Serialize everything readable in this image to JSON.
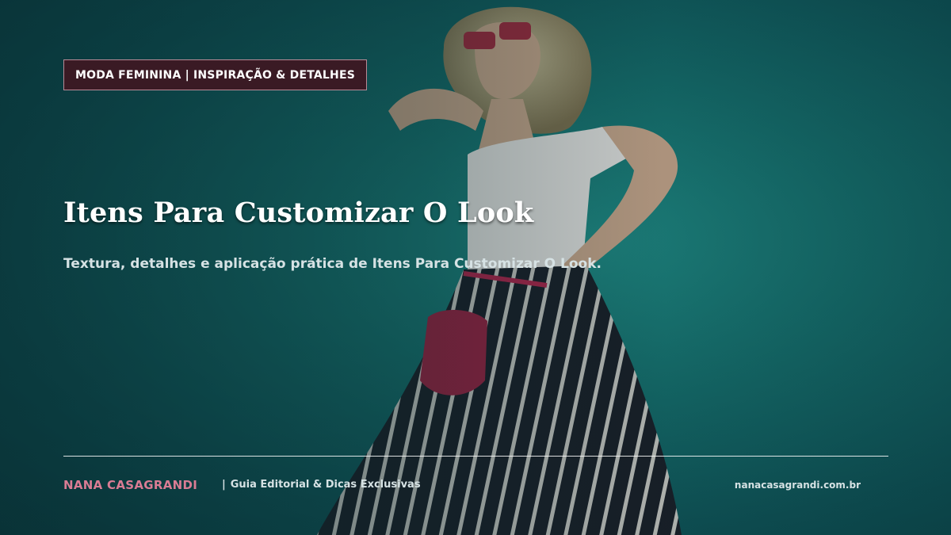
{
  "badge": {
    "label": "MODA FEMININA | INSPIRAÇÃO & DETALHES"
  },
  "hero": {
    "title": "Itens Para Customizar O Look",
    "subtitle": "Textura, detalhes e aplicação prática de Itens Para Customizar O Look."
  },
  "footer": {
    "brand": "NANA CASAGRANDI",
    "separator": "|",
    "tagline": "Guia Editorial & Dicas Exclusivas",
    "site": "nanacasagrandi.com.br"
  },
  "colors": {
    "background": "#156e6c",
    "badge_bg": "#3a1a24",
    "brand_accent": "#d97c94"
  },
  "image": {
    "icon": "fashion-photo-woman"
  }
}
